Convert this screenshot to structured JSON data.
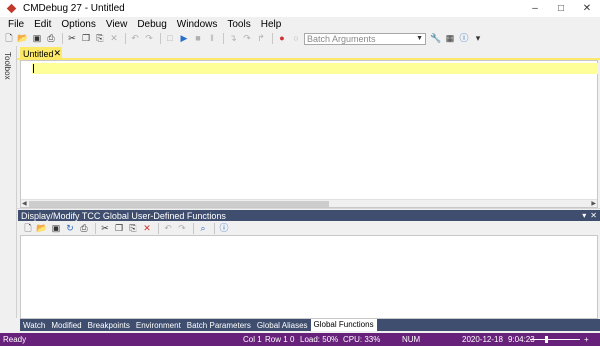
{
  "window": {
    "title": "CMDebug 27 - Untitled",
    "minimize": "–",
    "maximize": "□",
    "close": "✕"
  },
  "menu": [
    "File",
    "Edit",
    "Options",
    "View",
    "Debug",
    "Windows",
    "Tools",
    "Help"
  ],
  "toolbar": {
    "batch_args_placeholder": "Batch Arguments",
    "icons": [
      "new-file-icon",
      "open-icon",
      "save-icon",
      "print-icon",
      "cut-icon",
      "copy-icon",
      "paste-icon",
      "delete-icon",
      "undo-icon",
      "redo-icon",
      "breakpoint-icon",
      "run-icon",
      "stop-icon",
      "pause-icon",
      "step-into-icon",
      "step-over-icon",
      "step-out-icon",
      "record-icon",
      "circle-icon",
      "wrench-icon",
      "toolbox-icon",
      "help-icon"
    ]
  },
  "sidebar": {
    "toolbox_label": "Toolbox"
  },
  "editor": {
    "tab_label": "Untitled",
    "tab_close": "✕"
  },
  "panel": {
    "title": "Display/Modify TCC Global User-Defined Functions",
    "pin": "▾",
    "close": "✕"
  },
  "bottom_tabs": [
    "Watch",
    "Modified",
    "Breakpoints",
    "Environment",
    "Batch Parameters",
    "Global Aliases",
    "Global Functions"
  ],
  "active_bottom_tab": "Global Functions",
  "status": {
    "ready": "Ready",
    "col": "Col 1",
    "row": "Row 1",
    "zero": "0",
    "load": "Load: 50%",
    "cpu": "CPU: 33%",
    "num": "NUM",
    "date": "2020-12-18",
    "time": "9:04:23",
    "zoom_minus": "−",
    "zoom_plus": "+"
  },
  "colors": {
    "accent_purple": "#68217a",
    "panel_header": "#3f4e6f",
    "tab_yellow": "#fde968"
  }
}
